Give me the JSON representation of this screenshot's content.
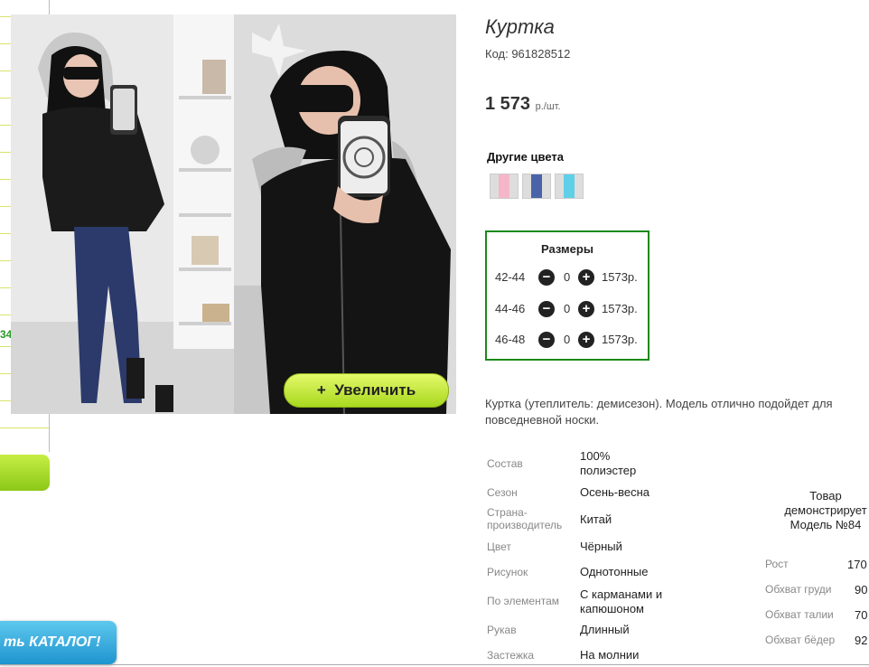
{
  "product": {
    "title": "Куртка",
    "code": "Код: 961828512",
    "price": "1 573",
    "price_unit": "р./шт.",
    "colors_title": "Другие цвета",
    "swatches": [
      {
        "color": "#f4b6c8",
        "name": "pink"
      },
      {
        "color": "#4a63a8",
        "name": "blue"
      },
      {
        "color": "#5fd0e8",
        "name": "cyan"
      }
    ],
    "zoom_button": "Увеличить",
    "zoom_icon": "+"
  },
  "sizes": {
    "title": "Размеры",
    "rows": [
      {
        "size": "42-44",
        "qty": "0",
        "price": "1573р."
      },
      {
        "size": "44-46",
        "qty": "0",
        "price": "1573р."
      },
      {
        "size": "46-48",
        "qty": "0",
        "price": "1573р."
      }
    ]
  },
  "description": "Куртка (утеплитель: демисезон). Модель отлично подойдет для повседневной носки.",
  "specs": [
    {
      "label": "Состав",
      "value": "100% полиэстер"
    },
    {
      "label": "Сезон",
      "value": "Осень-весна"
    },
    {
      "label": "Страна-производитель",
      "value": "Китай"
    },
    {
      "label": "Цвет",
      "value": "Чёрный"
    },
    {
      "label": "Рисунок",
      "value": "Однотонные"
    },
    {
      "label": "По элементам",
      "value": "С карманами и капюшоном"
    },
    {
      "label": "Рукав",
      "value": "Длинный"
    },
    {
      "label": "Застежка",
      "value": "На молнии"
    }
  ],
  "model": {
    "title": "Товар демонстрирует Модель №84",
    "params": [
      {
        "label": "Рост",
        "value": "170"
      },
      {
        "label": "Обхват груди",
        "value": "90"
      },
      {
        "label": "Обхват талии",
        "value": "70"
      },
      {
        "label": "Обхват бёдер",
        "value": "92"
      }
    ]
  },
  "sidebar": {
    "number": "34",
    "catalog_button": "ть КАТАЛОГ!"
  },
  "colors": {
    "accent_green": "#1a8a1a",
    "button_green": "#a8d81e",
    "catalog_blue": "#1e94cf"
  }
}
